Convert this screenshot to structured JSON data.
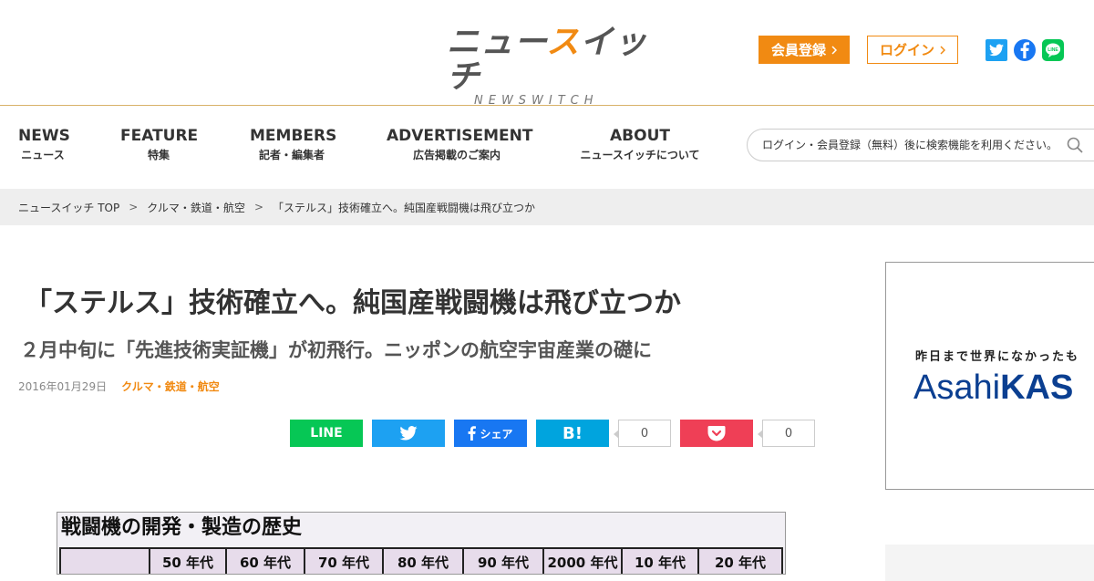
{
  "header": {
    "logo_jp_part1": "ニュー",
    "logo_jp_accent": "ス",
    "logo_jp_part2": "イッチ",
    "logo_en": "NEWSWITCH",
    "register_label": "会員登録",
    "login_label": "ログイン",
    "colors": {
      "accent": "#f18a12",
      "twitter": "#1da1f2",
      "facebook": "#1877f2",
      "line": "#06c755"
    }
  },
  "nav": {
    "items": [
      {
        "en": "NEWS",
        "jp": "ニュース"
      },
      {
        "en": "FEATURE",
        "jp": "特集"
      },
      {
        "en": "MEMBERS",
        "jp": "記者・編集者"
      },
      {
        "en": "ADVERTISEMENT",
        "jp": "広告掲載のご案内"
      },
      {
        "en": "ABOUT",
        "jp": "ニュースイッチについて"
      }
    ],
    "search_placeholder": "ログイン・会員登録（無料）後に検索機能を利用ください。"
  },
  "breadcrumb": {
    "items": [
      "ニュースイッチ TOP",
      "クルマ・鉄道・航空",
      "「ステルス」技術確立へ。純国産戦闘機は飛び立つか"
    ],
    "separator": ">"
  },
  "article": {
    "title": "「ステルス」技術確立へ。純国産戦闘機は飛び立つか",
    "subtitle": "２月中旬に「先進技術実証機」が初飛行。ニッポンの航空宇宙産業の礎に",
    "date": "2016年01月29日",
    "category": "クルマ・鉄道・航空"
  },
  "share": {
    "line_label": "LINE",
    "facebook_label": "シェア",
    "hatena_label": "B!",
    "hatena_count": "0",
    "pocket_count": "0"
  },
  "figure": {
    "title": "戦闘機の開発・製造の歴史",
    "columns": [
      "50 年代",
      "60 年代",
      "70 年代",
      "80 年代",
      "90 年代",
      "2000 年代",
      "10 年代",
      "20 年代"
    ]
  },
  "ad": {
    "tagline": "昨日まで世界になかったも",
    "brand_a": "Asahi",
    "brand_b": "KAS"
  }
}
